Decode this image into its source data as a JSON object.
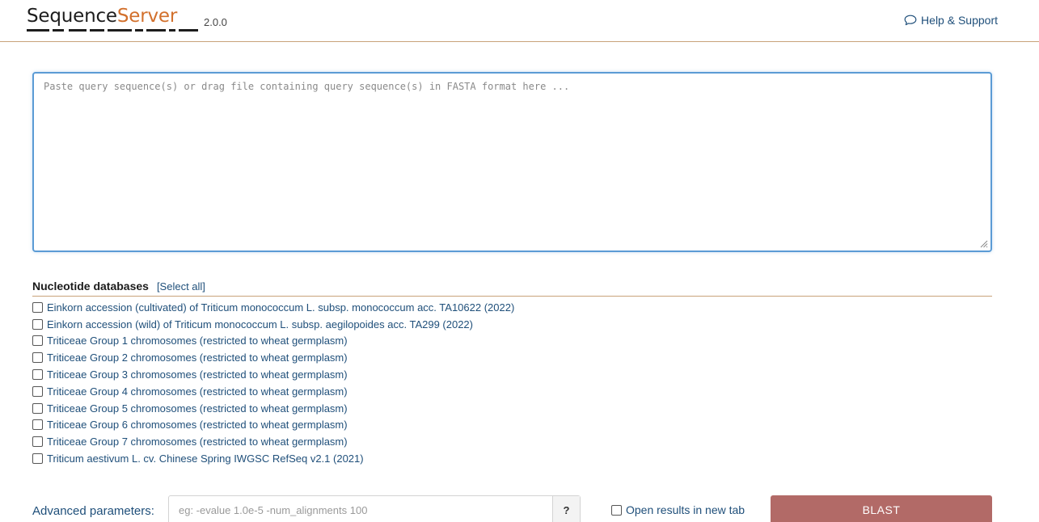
{
  "header": {
    "logo_part1": "Sequence",
    "logo_part2": "Server",
    "version": "2.0.0",
    "help_icon": "speech-bubble-icon",
    "help_label": "Help & Support"
  },
  "query": {
    "placeholder": "Paste query sequence(s) or drag file containing query sequence(s) in FASTA format here ...",
    "value": ""
  },
  "databases": {
    "title": "Nucleotide databases",
    "select_all": "[Select all]",
    "items": [
      {
        "label": "Einkorn accession (cultivated) of Triticum monococcum L. subsp. monococcum acc. TA10622 (2022)",
        "checked": false
      },
      {
        "label": "Einkorn accession (wild) of Triticum monococcum L. subsp. aegilopoides acc. TA299 (2022)",
        "checked": false
      },
      {
        "label": "Triticeae Group 1 chromosomes (restricted to wheat germplasm)",
        "checked": false
      },
      {
        "label": "Triticeae Group 2 chromosomes (restricted to wheat germplasm)",
        "checked": false
      },
      {
        "label": "Triticeae Group 3 chromosomes (restricted to wheat germplasm)",
        "checked": false
      },
      {
        "label": "Triticeae Group 4 chromosomes (restricted to wheat germplasm)",
        "checked": false
      },
      {
        "label": "Triticeae Group 5 chromosomes (restricted to wheat germplasm)",
        "checked": false
      },
      {
        "label": "Triticeae Group 6 chromosomes (restricted to wheat germplasm)",
        "checked": false
      },
      {
        "label": "Triticeae Group 7 chromosomes (restricted to wheat germplasm)",
        "checked": false
      },
      {
        "label": "Triticum aestivum L. cv. Chinese Spring IWGSC RefSeq v2.1 (2021)",
        "checked": false
      }
    ]
  },
  "advanced": {
    "label": "Advanced parameters:",
    "placeholder": "eg: -evalue 1.0e-5 -num_alignments 100",
    "value": "",
    "help_label": "?"
  },
  "options": {
    "new_tab_label": "Open results in new tab",
    "new_tab_checked": false
  },
  "submit": {
    "label": "BLAST"
  },
  "colors": {
    "accent": "#d2702c",
    "link": "#1f4f7a",
    "focus": "#5b9bd5",
    "divider": "#c8a27a",
    "button": "#b26a67"
  }
}
